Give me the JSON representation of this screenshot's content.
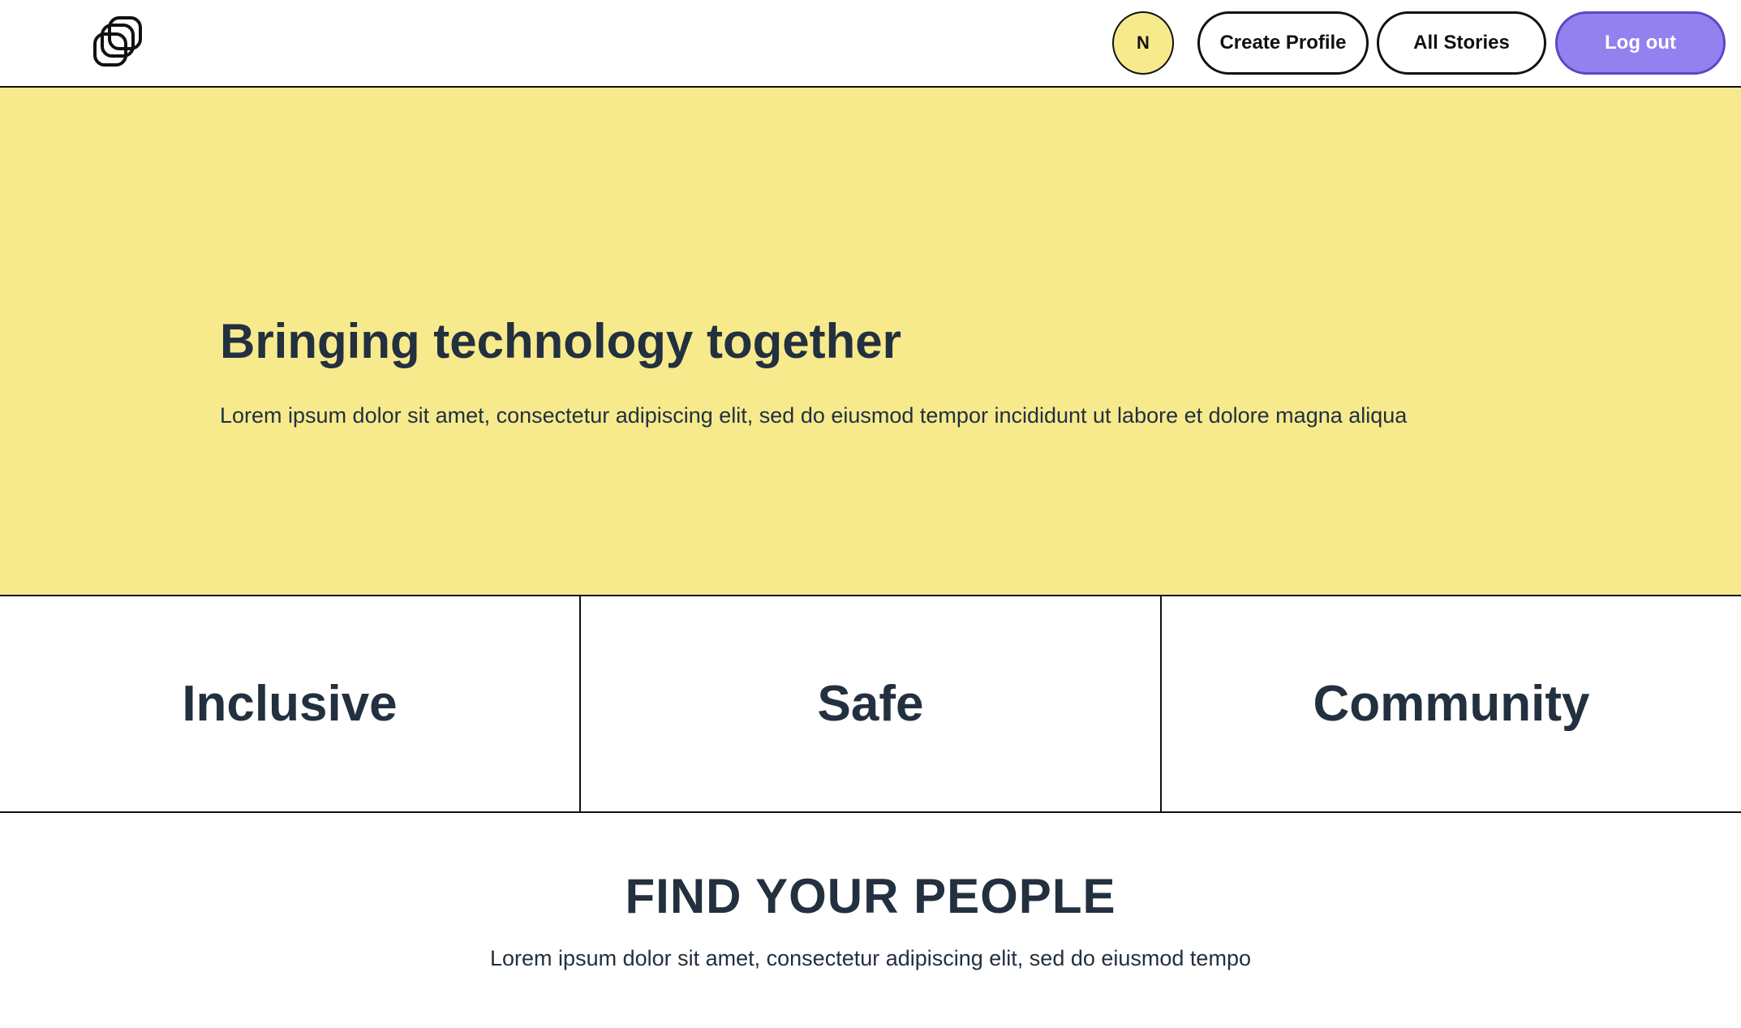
{
  "header": {
    "logo_icon": "overlapping-squares-logo-icon",
    "avatar_initial": "N",
    "create_profile_label": "Create Profile",
    "all_stories_label": "All Stories",
    "logout_label": "Log out"
  },
  "hero": {
    "title": "Bringing technology together",
    "text": "Lorem ipsum dolor sit amet, consectetur adipiscing elit, sed do eiusmod tempor incididunt ut labore et dolore magna aliqua"
  },
  "values": [
    "Inclusive",
    "Safe",
    "Community"
  ],
  "find": {
    "title": "FIND YOUR PEOPLE",
    "text": "Lorem ipsum dolor sit amet, consectetur adipiscing elit, sed do eiusmod tempo"
  },
  "colors": {
    "hero_background": "#f7ea8d",
    "logout_button": "#9381f0",
    "text_dark": "#22303f"
  }
}
